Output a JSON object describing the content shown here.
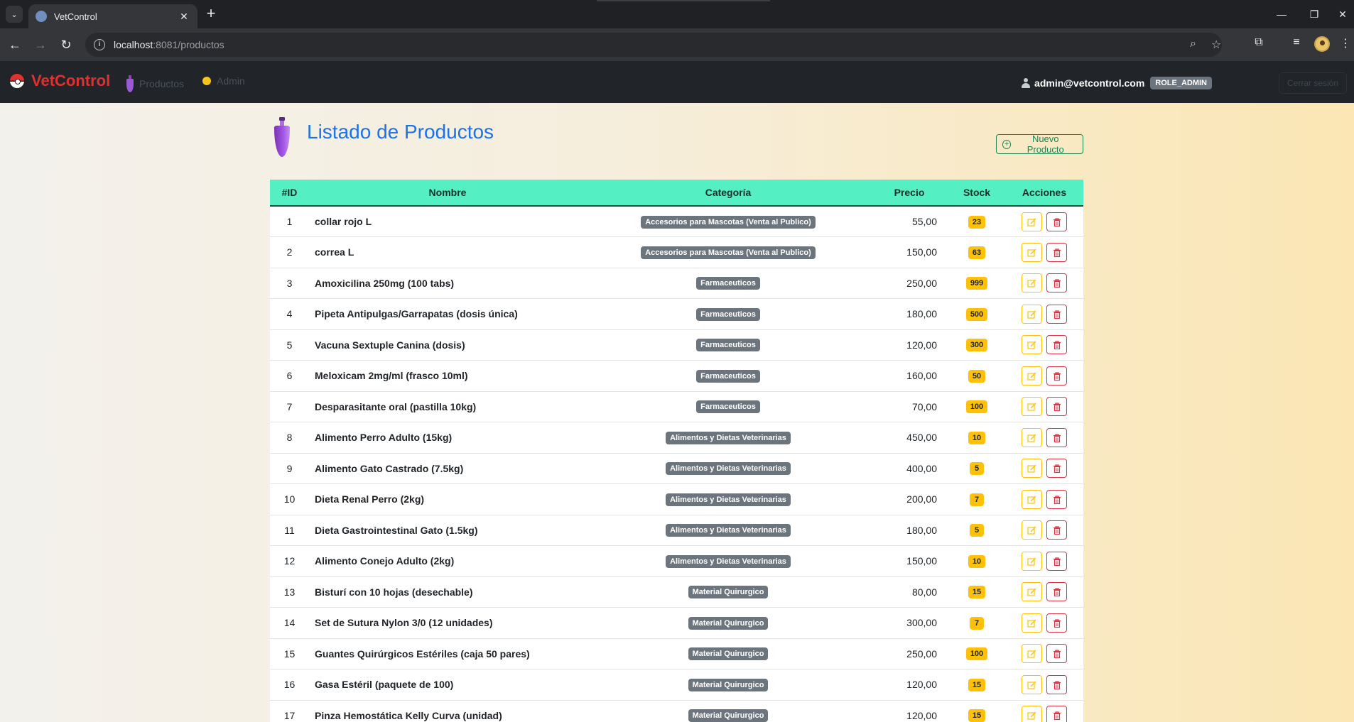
{
  "browser": {
    "tab_title": "VetControl",
    "tab_close": "✕",
    "url_host": "localhost",
    "url_rest": ":8081/productos",
    "icons": [
      "tab-search-icon",
      "favicon-icon",
      "new-tab-icon",
      "back-icon",
      "forward-icon",
      "reload-icon",
      "site-info-icon",
      "zoom-icon",
      "bookmark-star-icon",
      "extensions-icon",
      "media-controls-icon",
      "profile-avatar-icon",
      "menu-kebab-icon",
      "minimize-icon",
      "maximize-icon",
      "close-window-icon"
    ]
  },
  "navbar": {
    "brand": "VetControl",
    "links": [
      {
        "label": "Productos",
        "icon": "potion-icon"
      },
      {
        "label": "Admin",
        "icon": "admin-face-icon"
      }
    ],
    "user_email": "admin@vetcontrol.com",
    "role": "ROLE_ADMIN",
    "logout": "Cerrar sesión"
  },
  "page": {
    "title": "Listado de Productos",
    "new_button": "Nuevo Producto",
    "accent_color": "#1a73e8",
    "header_color": "#55efc4"
  },
  "table": {
    "headers": {
      "id": "#ID",
      "name": "Nombre",
      "category": "Categoría",
      "price": "Precio",
      "stock": "Stock",
      "actions": "Acciones"
    },
    "rows": [
      {
        "id": "1",
        "name": "collar rojo L",
        "category": "Accesorios para Mascotas (Venta al Publico)",
        "price": "55,00",
        "stock": "23"
      },
      {
        "id": "2",
        "name": "correa L",
        "category": "Accesorios para Mascotas (Venta al Publico)",
        "price": "150,00",
        "stock": "63"
      },
      {
        "id": "3",
        "name": "Amoxicilina 250mg (100 tabs)",
        "category": "Farmaceuticos",
        "price": "250,00",
        "stock": "999"
      },
      {
        "id": "4",
        "name": "Pipeta Antipulgas/Garrapatas (dosis única)",
        "category": "Farmaceuticos",
        "price": "180,00",
        "stock": "500"
      },
      {
        "id": "5",
        "name": "Vacuna Sextuple Canina (dosis)",
        "category": "Farmaceuticos",
        "price": "120,00",
        "stock": "300"
      },
      {
        "id": "6",
        "name": "Meloxicam 2mg/ml (frasco 10ml)",
        "category": "Farmaceuticos",
        "price": "160,00",
        "stock": "50"
      },
      {
        "id": "7",
        "name": "Desparasitante oral (pastilla 10kg)",
        "category": "Farmaceuticos",
        "price": "70,00",
        "stock": "100"
      },
      {
        "id": "8",
        "name": "Alimento Perro Adulto (15kg)",
        "category": "Alimentos y Dietas Veterinarias",
        "price": "450,00",
        "stock": "10"
      },
      {
        "id": "9",
        "name": "Alimento Gato Castrado (7.5kg)",
        "category": "Alimentos y Dietas Veterinarias",
        "price": "400,00",
        "stock": "5"
      },
      {
        "id": "10",
        "name": "Dieta Renal Perro (2kg)",
        "category": "Alimentos y Dietas Veterinarias",
        "price": "200,00",
        "stock": "7"
      },
      {
        "id": "11",
        "name": "Dieta Gastrointestinal Gato (1.5kg)",
        "category": "Alimentos y Dietas Veterinarias",
        "price": "180,00",
        "stock": "5"
      },
      {
        "id": "12",
        "name": "Alimento Conejo Adulto (2kg)",
        "category": "Alimentos y Dietas Veterinarias",
        "price": "150,00",
        "stock": "10"
      },
      {
        "id": "13",
        "name": "Bisturí con 10 hojas (desechable)",
        "category": "Material Quirurgico",
        "price": "80,00",
        "stock": "15"
      },
      {
        "id": "14",
        "name": "Set de Sutura Nylon 3/0 (12 unidades)",
        "category": "Material Quirurgico",
        "price": "300,00",
        "stock": "7"
      },
      {
        "id": "15",
        "name": "Guantes Quirúrgicos Estériles (caja 50 pares)",
        "category": "Material Quirurgico",
        "price": "250,00",
        "stock": "100"
      },
      {
        "id": "16",
        "name": "Gasa Estéril (paquete de 100)",
        "category": "Material Quirurgico",
        "price": "120,00",
        "stock": "15"
      },
      {
        "id": "17",
        "name": "Pinza Hemostática Kelly Curva (unidad)",
        "category": "Material Quirurgico",
        "price": "120,00",
        "stock": "15"
      }
    ]
  }
}
